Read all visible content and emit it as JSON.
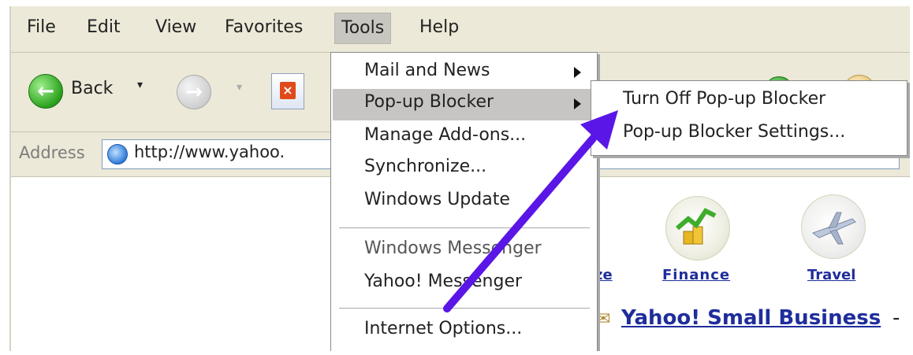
{
  "menubar": {
    "items": [
      "File",
      "Edit",
      "View",
      "Favorites",
      "Tools",
      "Help"
    ],
    "active": "Tools"
  },
  "toolbar": {
    "back_label": "Back",
    "back_dropdown": "▾",
    "forward_dropdown": "▾",
    "stop_glyph": "×"
  },
  "address": {
    "label": "Address",
    "url": "http://www.yahoo."
  },
  "tools_menu": {
    "items": [
      {
        "label": "Mail and News",
        "submenu": true
      },
      {
        "label": "Pop-up Blocker",
        "submenu": true,
        "highlighted": true
      },
      {
        "label": "Manage Add-ons..."
      },
      {
        "label": "Synchronize..."
      },
      {
        "label": "Windows Update"
      },
      {
        "label": "Windows Messenger"
      },
      {
        "label": "Yahoo! Messenger"
      },
      {
        "label": "Internet Options..."
      }
    ]
  },
  "popup_submenu": {
    "items": [
      "Turn Off Pop-up Blocker",
      "Pop-up Blocker Settings..."
    ]
  },
  "content": {
    "links": [
      "ze",
      "Finance",
      "Travel"
    ],
    "banner": "Yahoo! Small Business",
    "banner_suffix": "-"
  },
  "colors": {
    "annotation_arrow": "#5a16e6",
    "link": "#1f2d9b",
    "menu_highlight": "#c6c5c3"
  }
}
